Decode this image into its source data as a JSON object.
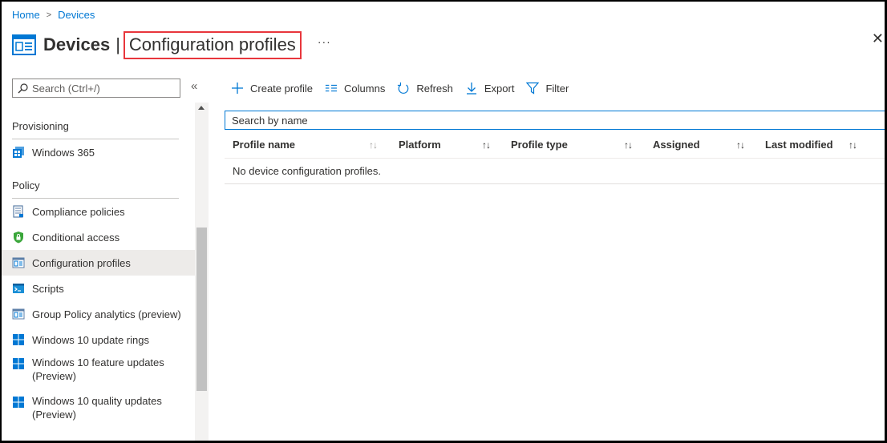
{
  "breadcrumb": {
    "home": "Home",
    "devices": "Devices",
    "separator": ">"
  },
  "header": {
    "title": "Devices",
    "pipe": "|",
    "subtitle": "Configuration profiles",
    "more": "···",
    "close": "✕"
  },
  "sidebar": {
    "search_placeholder": "Search (Ctrl+/)",
    "collapse": "«",
    "sections": [
      {
        "title": "Provisioning"
      },
      {
        "title": "Policy"
      }
    ],
    "provisioning_items": [
      {
        "label": "Windows 365",
        "icon": "windows365-icon"
      }
    ],
    "policy_items": [
      {
        "label": "Compliance policies",
        "icon": "compliance-icon"
      },
      {
        "label": "Conditional access",
        "icon": "shield-lock-icon"
      },
      {
        "label": "Configuration profiles",
        "icon": "config-profile-icon",
        "active": true
      },
      {
        "label": "Scripts",
        "icon": "script-icon"
      },
      {
        "label": "Group Policy analytics (preview)",
        "icon": "gp-analytics-icon"
      },
      {
        "label": "Windows 10 update rings",
        "icon": "windows-icon"
      },
      {
        "label": "Windows 10 feature updates (Preview)",
        "icon": "windows-icon"
      },
      {
        "label": "Windows 10 quality updates (Preview)",
        "icon": "windows-icon"
      }
    ]
  },
  "toolbar": {
    "create": "Create profile",
    "columns": "Columns",
    "refresh": "Refresh",
    "export": "Export",
    "filter": "Filter"
  },
  "main": {
    "search_placeholder": "Search by name",
    "columns": [
      "Profile name",
      "Platform",
      "Profile type",
      "Assigned",
      "Last modified"
    ],
    "empty_message": "No device configuration profiles."
  },
  "colors": {
    "accent": "#0078d4",
    "highlight_border": "#e8363c",
    "active_bg": "#edebe9"
  }
}
